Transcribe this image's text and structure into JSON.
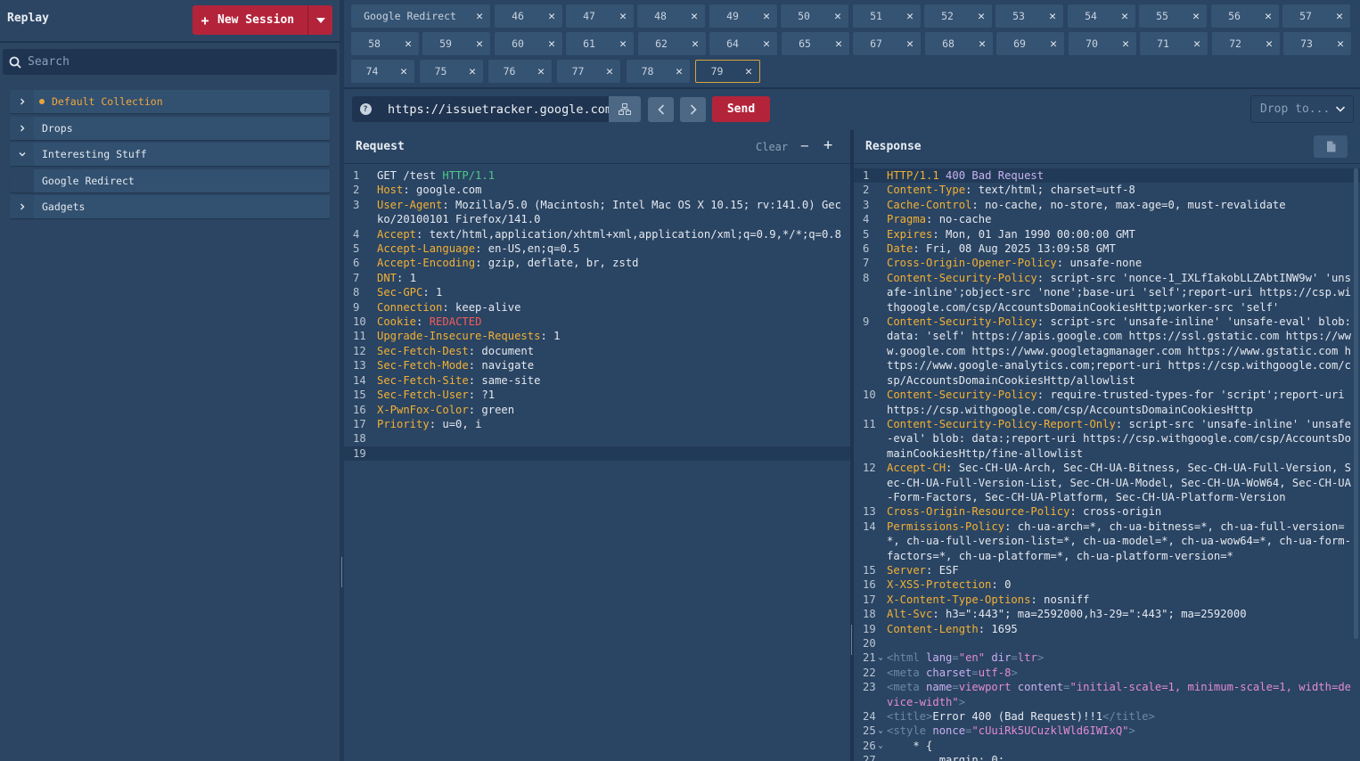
{
  "sidebar": {
    "app_title": "Replay",
    "new_session_label": "New Session",
    "search_placeholder": "Search",
    "collections": [
      {
        "label": "Default Collection",
        "expanded": false,
        "active": true
      },
      {
        "label": "Drops",
        "expanded": false
      },
      {
        "label": "Interesting Stuff",
        "expanded": true
      },
      {
        "label": "Google Redirect",
        "child": true
      },
      {
        "label": "Gadgets",
        "expanded": false
      }
    ]
  },
  "tabs": [
    "Google Redirect",
    "46",
    "47",
    "48",
    "49",
    "50",
    "51",
    "52",
    "53",
    "54",
    "55",
    "56",
    "57",
    "58",
    "59",
    "60",
    "61",
    "62",
    "64",
    "65",
    "67",
    "68",
    "69",
    "70",
    "71",
    "72",
    "73",
    "74",
    "75",
    "76",
    "77",
    "78",
    "79"
  ],
  "selected_tab": "79",
  "urlbar": {
    "url": "https://issuetracker.google.com",
    "send_label": "Send",
    "drop_placeholder": "Drop to..."
  },
  "request": {
    "title": "Request",
    "clear_label": "Clear",
    "lines": [
      {
        "n": "1",
        "parts": [
          [
            "",
            "GET /test "
          ],
          [
            "ver",
            "HTTP/1.1"
          ]
        ]
      },
      {
        "n": "2",
        "parts": [
          [
            "hdr",
            "Host"
          ],
          [
            "",
            ": google.com"
          ]
        ]
      },
      {
        "n": "3",
        "parts": [
          [
            "hdr",
            "User-Agent"
          ],
          [
            "",
            ": Mozilla/5.0 (Macintosh; Intel Mac OS X 10.15; rv:141.0) Gecko/20100101 Firefox/141.0"
          ]
        ]
      },
      {
        "n": "4",
        "parts": [
          [
            "hdr",
            "Accept"
          ],
          [
            "",
            ": text/html,application/xhtml+xml,application/xml;q=0.9,*/*;q=0.8"
          ]
        ]
      },
      {
        "n": "5",
        "parts": [
          [
            "hdr",
            "Accept-Language"
          ],
          [
            "",
            ": en-US,en;q=0.5"
          ]
        ]
      },
      {
        "n": "6",
        "parts": [
          [
            "hdr",
            "Accept-Encoding"
          ],
          [
            "",
            ": gzip, deflate, br, zstd"
          ]
        ]
      },
      {
        "n": "7",
        "parts": [
          [
            "hdr",
            "DNT"
          ],
          [
            "",
            ": 1"
          ]
        ]
      },
      {
        "n": "8",
        "parts": [
          [
            "hdr",
            "Sec-GPC"
          ],
          [
            "",
            ": 1"
          ]
        ]
      },
      {
        "n": "9",
        "parts": [
          [
            "hdr",
            "Connection"
          ],
          [
            "",
            ": keep-alive"
          ]
        ]
      },
      {
        "n": "10",
        "parts": [
          [
            "hdr",
            "Cookie"
          ],
          [
            "",
            ": "
          ],
          [
            "red",
            "REDACTED"
          ]
        ]
      },
      {
        "n": "11",
        "parts": [
          [
            "hdr",
            "Upgrade-Insecure-Requests"
          ],
          [
            "",
            ": 1"
          ]
        ]
      },
      {
        "n": "12",
        "parts": [
          [
            "hdr",
            "Sec-Fetch-Dest"
          ],
          [
            "",
            ": document"
          ]
        ]
      },
      {
        "n": "13",
        "parts": [
          [
            "hdr",
            "Sec-Fetch-Mode"
          ],
          [
            "",
            ": navigate"
          ]
        ]
      },
      {
        "n": "14",
        "parts": [
          [
            "hdr",
            "Sec-Fetch-Site"
          ],
          [
            "",
            ": same-site"
          ]
        ]
      },
      {
        "n": "15",
        "parts": [
          [
            "hdr",
            "Sec-Fetch-User"
          ],
          [
            "",
            ": ?1"
          ]
        ]
      },
      {
        "n": "16",
        "parts": [
          [
            "hdr",
            "X-PwnFox-Color"
          ],
          [
            "",
            ": green"
          ]
        ]
      },
      {
        "n": "17",
        "parts": [
          [
            "hdr",
            "Priority"
          ],
          [
            "",
            ": u=0, i"
          ]
        ]
      },
      {
        "n": "18",
        "parts": []
      },
      {
        "n": "19",
        "parts": [],
        "current": true
      }
    ]
  },
  "response": {
    "title": "Response",
    "lines": [
      {
        "n": "1",
        "parts": [
          [
            "hdr",
            "HTTP/1.1 "
          ],
          [
            "bad",
            "400 Bad Request"
          ]
        ],
        "current": true
      },
      {
        "n": "2",
        "parts": [
          [
            "hdr",
            "Content-Type"
          ],
          [
            "",
            ": text/html; charset=utf-8"
          ]
        ]
      },
      {
        "n": "3",
        "parts": [
          [
            "hdr",
            "Cache-Control"
          ],
          [
            "",
            ": no-cache, no-store, max-age=0, must-revalidate"
          ]
        ]
      },
      {
        "n": "4",
        "parts": [
          [
            "hdr",
            "Pragma"
          ],
          [
            "",
            ": no-cache"
          ]
        ]
      },
      {
        "n": "5",
        "parts": [
          [
            "hdr",
            "Expires"
          ],
          [
            "",
            ": Mon, 01 Jan 1990 00:00:00 GMT"
          ]
        ]
      },
      {
        "n": "6",
        "parts": [
          [
            "hdr",
            "Date"
          ],
          [
            "",
            ": Fri, 08 Aug 2025 13:09:58 GMT"
          ]
        ]
      },
      {
        "n": "7",
        "parts": [
          [
            "hdr",
            "Cross-Origin-Opener-Policy"
          ],
          [
            "",
            ": unsafe-none"
          ]
        ]
      },
      {
        "n": "8",
        "parts": [
          [
            "hdr",
            "Content-Security-Policy"
          ],
          [
            "",
            ": script-src 'nonce-1_IXLfIakobLLZAbtINW9w' 'unsafe-inline';object-src 'none';base-uri 'self';report-uri https://csp.withgoogle.com/csp/AccountsDomainCookiesHttp;worker-src 'self'"
          ]
        ]
      },
      {
        "n": "9",
        "parts": [
          [
            "hdr",
            "Content-Security-Policy"
          ],
          [
            "",
            ": script-src 'unsafe-inline' 'unsafe-eval' blob: data: 'self' https://apis.google.com https://ssl.gstatic.com https://www.google.com https://www.googletagmanager.com https://www.gstatic.com https://www.google-analytics.com;report-uri https://csp.withgoogle.com/csp/AccountsDomainCookiesHttp/allowlist"
          ]
        ]
      },
      {
        "n": "10",
        "parts": [
          [
            "hdr",
            "Content-Security-Policy"
          ],
          [
            "",
            ": require-trusted-types-for 'script';report-uri https://csp.withgoogle.com/csp/AccountsDomainCookiesHttp"
          ]
        ]
      },
      {
        "n": "11",
        "parts": [
          [
            "hdr",
            "Content-Security-Policy-Report-Only"
          ],
          [
            "",
            ": script-src 'unsafe-inline' 'unsafe-eval' blob: data:;report-uri https://csp.withgoogle.com/csp/AccountsDomainCookiesHttp/fine-allowlist"
          ]
        ]
      },
      {
        "n": "12",
        "parts": [
          [
            "hdr",
            "Accept-CH"
          ],
          [
            "",
            ": Sec-CH-UA-Arch, Sec-CH-UA-Bitness, Sec-CH-UA-Full-Version, Sec-CH-UA-Full-Version-List, Sec-CH-UA-Model, Sec-CH-UA-WoW64, Sec-CH-UA-Form-Factors, Sec-CH-UA-Platform, Sec-CH-UA-Platform-Version"
          ]
        ]
      },
      {
        "n": "13",
        "parts": [
          [
            "hdr",
            "Cross-Origin-Resource-Policy"
          ],
          [
            "",
            ": cross-origin"
          ]
        ]
      },
      {
        "n": "14",
        "parts": [
          [
            "hdr",
            "Permissions-Policy"
          ],
          [
            "",
            ": ch-ua-arch=*, ch-ua-bitness=*, ch-ua-full-version=*, ch-ua-full-version-list=*, ch-ua-model=*, ch-ua-wow64=*, ch-ua-form-factors=*, ch-ua-platform=*, ch-ua-platform-version=*"
          ]
        ]
      },
      {
        "n": "15",
        "parts": [
          [
            "hdr",
            "Server"
          ],
          [
            "",
            ": ESF"
          ]
        ]
      },
      {
        "n": "16",
        "parts": [
          [
            "hdr",
            "X-XSS-Protection"
          ],
          [
            "",
            ": 0"
          ]
        ]
      },
      {
        "n": "17",
        "parts": [
          [
            "hdr",
            "X-Content-Type-Options"
          ],
          [
            "",
            ": nosniff"
          ]
        ]
      },
      {
        "n": "18",
        "parts": [
          [
            "hdr",
            "Alt-Svc"
          ],
          [
            "",
            ": h3=\":443\"; ma=2592000,h3-29=\":443\"; ma=2592000"
          ]
        ]
      },
      {
        "n": "19",
        "parts": [
          [
            "hdr",
            "Content-Length"
          ],
          [
            "",
            ": 1695"
          ]
        ]
      },
      {
        "n": "20",
        "parts": []
      },
      {
        "n": "21",
        "fold": true,
        "parts": [
          [
            "tag",
            "<html "
          ],
          [
            "attr",
            "lang"
          ],
          [
            "tag",
            "="
          ],
          [
            "str",
            "\"en\""
          ],
          [
            "attr",
            " dir"
          ],
          [
            "tag",
            "="
          ],
          [
            "str",
            "ltr"
          ],
          [
            "tag",
            ">"
          ]
        ]
      },
      {
        "n": "22",
        "parts": [
          [
            "tag",
            "<meta "
          ],
          [
            "attr",
            "charset"
          ],
          [
            "tag",
            "="
          ],
          [
            "str",
            "utf-8"
          ],
          [
            "tag",
            ">"
          ]
        ]
      },
      {
        "n": "23",
        "parts": [
          [
            "tag",
            "<meta "
          ],
          [
            "attr",
            "name"
          ],
          [
            "tag",
            "="
          ],
          [
            "str",
            "viewport"
          ],
          [
            "attr",
            " content"
          ],
          [
            "tag",
            "="
          ],
          [
            "str",
            "\"initial-scale=1, minimum-scale=1, width=device-width\""
          ],
          [
            "tag",
            ">"
          ]
        ]
      },
      {
        "n": "24",
        "parts": [
          [
            "tag",
            "<title>"
          ],
          [
            "",
            "Error 400 (Bad Request)!!1"
          ],
          [
            "tag",
            "</title>"
          ]
        ]
      },
      {
        "n": "25",
        "fold": true,
        "parts": [
          [
            "tag",
            "<style "
          ],
          [
            "attr",
            "nonce"
          ],
          [
            "tag",
            "="
          ],
          [
            "str",
            "\"cUuiRk5UCuzklWld6IWIxQ\""
          ],
          [
            "tag",
            ">"
          ]
        ]
      },
      {
        "n": "26",
        "fold": true,
        "parts": [
          [
            "",
            "    * {"
          ]
        ]
      },
      {
        "n": "27",
        "parts": [
          [
            "",
            "        margin: 0;"
          ]
        ]
      }
    ]
  },
  "colors": {
    "background": "#2a4463",
    "accent_red": "#b3243b",
    "header_key": "#f2b134",
    "http_version": "#4fc98a",
    "selected_tab_border": "#d8a440"
  }
}
